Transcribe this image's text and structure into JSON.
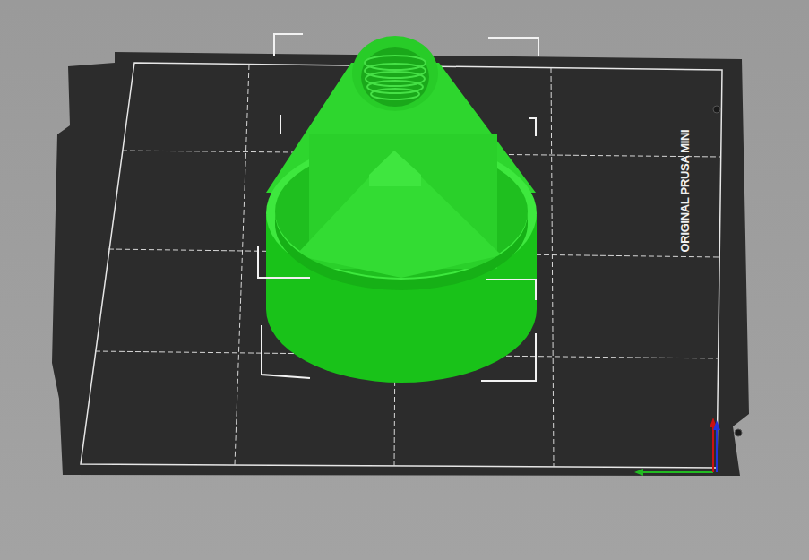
{
  "bed": {
    "label": "ORIGINAL PRUSA MINI"
  },
  "object": {
    "selected": true
  }
}
